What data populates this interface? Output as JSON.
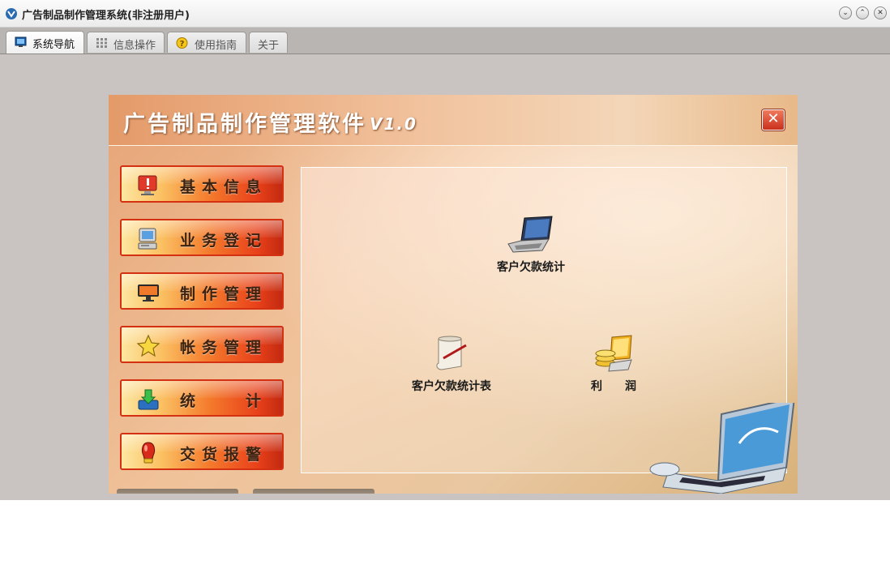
{
  "window": {
    "title": "广告制品制作管理系统(非注册用户)"
  },
  "window_controls": [
    "minimize",
    "maximize",
    "close"
  ],
  "tabs": [
    {
      "label": "系统导航",
      "icon": "monitor-icon",
      "active": true
    },
    {
      "label": "信息操作",
      "icon": "grid-icon",
      "active": false
    },
    {
      "label": "使用指南",
      "icon": "help-icon",
      "active": false
    },
    {
      "label": "关于",
      "icon": "",
      "active": false
    }
  ],
  "panel": {
    "title": "广告制品制作管理软件",
    "version": "V1.0"
  },
  "menu": [
    {
      "label": "基本信息",
      "icon": "alert-monitor-icon"
    },
    {
      "label": "业务登记",
      "icon": "computer-icon"
    },
    {
      "label": "制作管理",
      "icon": "display-icon"
    },
    {
      "label": "帐务管理",
      "icon": "star-icon"
    },
    {
      "label": "统　　计",
      "icon": "download-tray-icon"
    },
    {
      "label": "交货报警",
      "icon": "alarm-bulb-icon"
    }
  ],
  "features": [
    {
      "label": "客户欠款统计",
      "icon": "laptop-icon"
    },
    {
      "label": "客户欠款统计表",
      "icon": "scroll-icon"
    },
    {
      "label": "利　　润",
      "icon": "coins-icon"
    }
  ],
  "colors": {
    "accent": "#e8401a",
    "panel_bg": "#f0c29a",
    "tab_bg": "#b9b5b3",
    "window_bg": "#c9c4c1"
  }
}
